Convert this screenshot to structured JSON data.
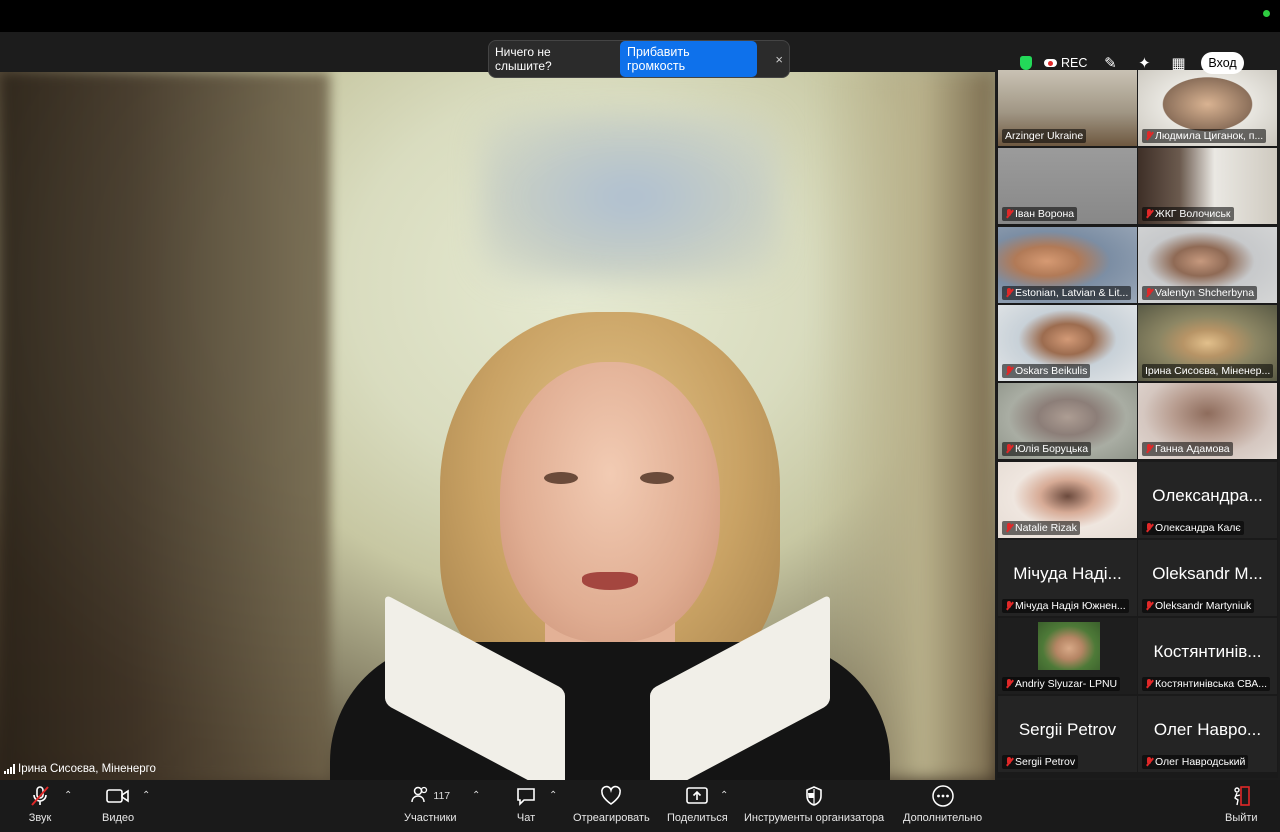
{
  "toast": {
    "message": "Ничего не слышите?",
    "button": "Прибавить громкость",
    "close": "×"
  },
  "top_controls": {
    "rec": "REC",
    "login": "Вход"
  },
  "main_speaker": {
    "name": "Ірина Сисоєва, Міненерго"
  },
  "gallery": [
    {
      "name": "Arzinger Ukraine",
      "muted": false,
      "video": true
    },
    {
      "name": "Людмила Циганок, п...",
      "muted": true,
      "video": true
    },
    {
      "name": "Іван Ворона",
      "muted": true,
      "video": true
    },
    {
      "name": "ЖКГ Волочиськ",
      "muted": true,
      "video": true
    },
    {
      "name": "Estonian, Latvian & Lit...",
      "muted": true,
      "video": true
    },
    {
      "name": "Valentyn Shcherbyna",
      "muted": true,
      "video": true
    },
    {
      "name": "Oskars Beikulis",
      "muted": true,
      "video": true
    },
    {
      "name": "Ірина Сисоєва, Міненер...",
      "muted": false,
      "video": true,
      "active": true
    },
    {
      "name": "Юлія Боруцька",
      "muted": true,
      "video": true
    },
    {
      "name": "Ганна Адамова",
      "muted": true,
      "video": true
    },
    {
      "name": "Natalie Rizak",
      "muted": true,
      "video": true
    },
    {
      "name": "Олександра Калє",
      "muted": true,
      "video": false,
      "display": "Олександра..."
    },
    {
      "name": "Мічуда Надія Южнен...",
      "muted": true,
      "video": false,
      "display": "Мічуда Наді..."
    },
    {
      "name": "Oleksandr Martyniuk",
      "muted": true,
      "video": false,
      "display": "Oleksandr M..."
    },
    {
      "name": "Andriy Slyuzar- LPNU",
      "muted": true,
      "video": true
    },
    {
      "name": "Костянтинівська СВА...",
      "muted": true,
      "video": false,
      "display": "Костянтинів..."
    },
    {
      "name": "Sergii Petrov",
      "muted": true,
      "video": false,
      "display": "Sergii Petrov"
    },
    {
      "name": "Олег Навродський",
      "muted": true,
      "video": false,
      "display": "Олег Навро..."
    }
  ],
  "toolbar": {
    "audio": "Звук",
    "video": "Видео",
    "participants": "Участники",
    "participants_count": "117",
    "chat": "Чат",
    "react": "Отреагировать",
    "share": "Поделиться",
    "host_tools": "Инструменты организатора",
    "more": "Дополнительно",
    "leave": "Выйти"
  }
}
